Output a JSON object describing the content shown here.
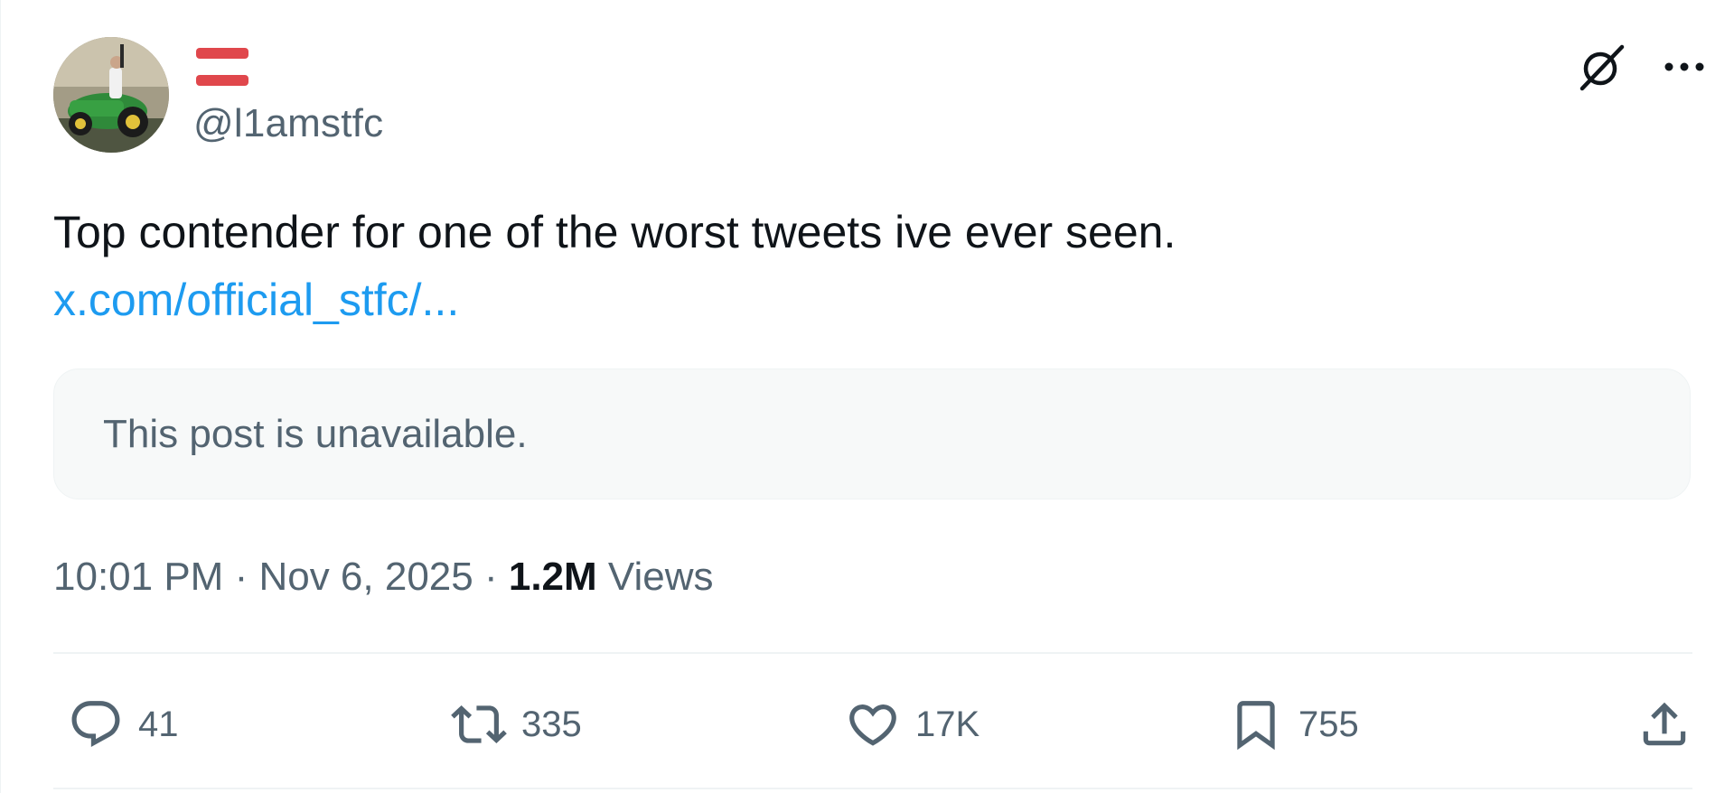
{
  "author": {
    "handle": "@l1amstfc"
  },
  "icons": {
    "flag": "flag-badge-icon",
    "grok": "grok-icon",
    "more": "more-icon",
    "reply": "reply-icon",
    "retweet": "retweet-icon",
    "like": "heart-icon",
    "bookmark": "bookmark-icon",
    "share": "share-icon"
  },
  "post": {
    "text": "Top contender for one of the worst tweets ive ever seen.",
    "link": "x.com/official_stfc/...",
    "quoted_unavailable": "This post is unavailable."
  },
  "meta": {
    "time": "10:01 PM",
    "separator1": " · ",
    "date": "Nov 6, 2025",
    "separator2": " · ",
    "views_count": "1.2M",
    "views_label": " Views"
  },
  "stats": {
    "replies": "41",
    "retweets": "335",
    "likes": "17K",
    "bookmarks": "755"
  },
  "colors": {
    "text": "#0f1419",
    "secondary": "#536471",
    "link": "#1d9bf0",
    "flag_red": "#e0474c",
    "quote_bg": "#f7f9f9",
    "divider": "#eff3f4"
  }
}
